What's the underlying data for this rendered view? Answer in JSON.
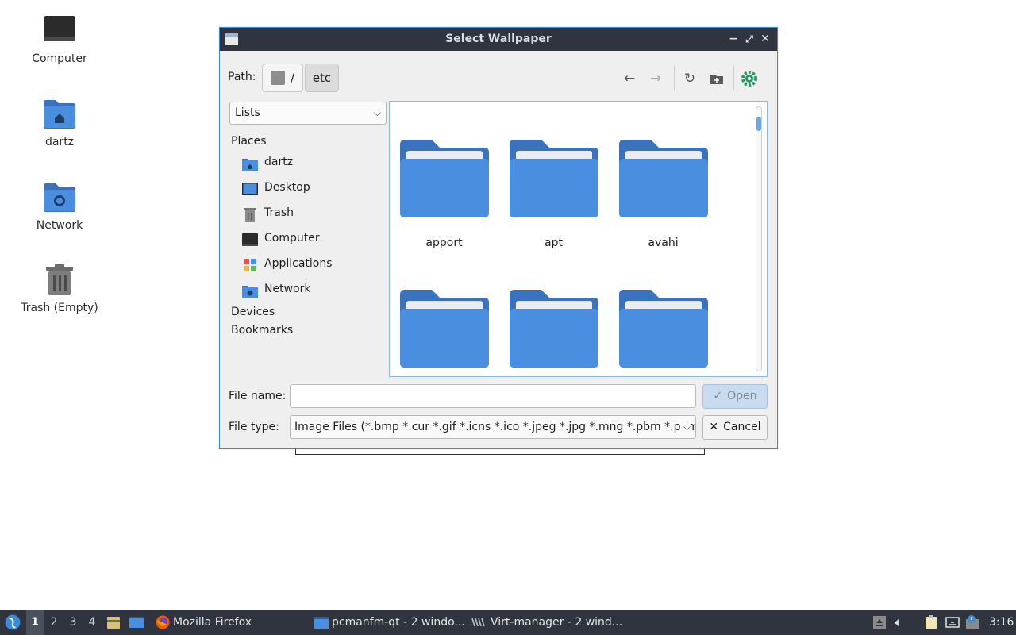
{
  "desktop": {
    "icons": [
      {
        "label": "Computer"
      },
      {
        "label": "dartz"
      },
      {
        "label": "Network"
      },
      {
        "label": "Trash (Empty)"
      }
    ]
  },
  "dialog": {
    "title": "Select Wallpaper",
    "path_label": "Path:",
    "path_root": "/",
    "path_current": "etc",
    "view_mode": "Lists",
    "places_header": "Places",
    "places": [
      {
        "label": "dartz",
        "icon": "home-folder-icon"
      },
      {
        "label": "Desktop",
        "icon": "desktop-icon"
      },
      {
        "label": "Trash",
        "icon": "trash-icon"
      },
      {
        "label": "Computer",
        "icon": "computer-icon"
      },
      {
        "label": "Applications",
        "icon": "applications-icon"
      },
      {
        "label": "Network",
        "icon": "network-folder-icon"
      }
    ],
    "devices_header": "Devices",
    "bookmarks_header": "Bookmarks",
    "files": [
      {
        "name": "apport"
      },
      {
        "name": "apt"
      },
      {
        "name": "avahi"
      },
      {
        "name": ""
      },
      {
        "name": ""
      },
      {
        "name": ""
      }
    ],
    "file_name_label": "File name:",
    "file_name_value": "",
    "file_type_label": "File type:",
    "file_type_value": "Image Files (*.bmp *.cur *.gif *.icns *.ico *.jpeg *.jpg *.mng *.pbm *.pgm",
    "open_label": "Open",
    "cancel_label": "Cancel"
  },
  "taskbar": {
    "workspaces": [
      "1",
      "2",
      "3",
      "4"
    ],
    "active_workspace": "1",
    "tasks": [
      {
        "label": "Mozilla Firefox"
      },
      {
        "label": "pcmanfm-qt - 2 windo..."
      },
      {
        "label": "Virt-manager - 2 wind..."
      }
    ],
    "clock": "3:16"
  },
  "colors": {
    "accent": "#3b8bd8",
    "folder": "#4a8ee0",
    "titlebar": "#2f343f"
  }
}
